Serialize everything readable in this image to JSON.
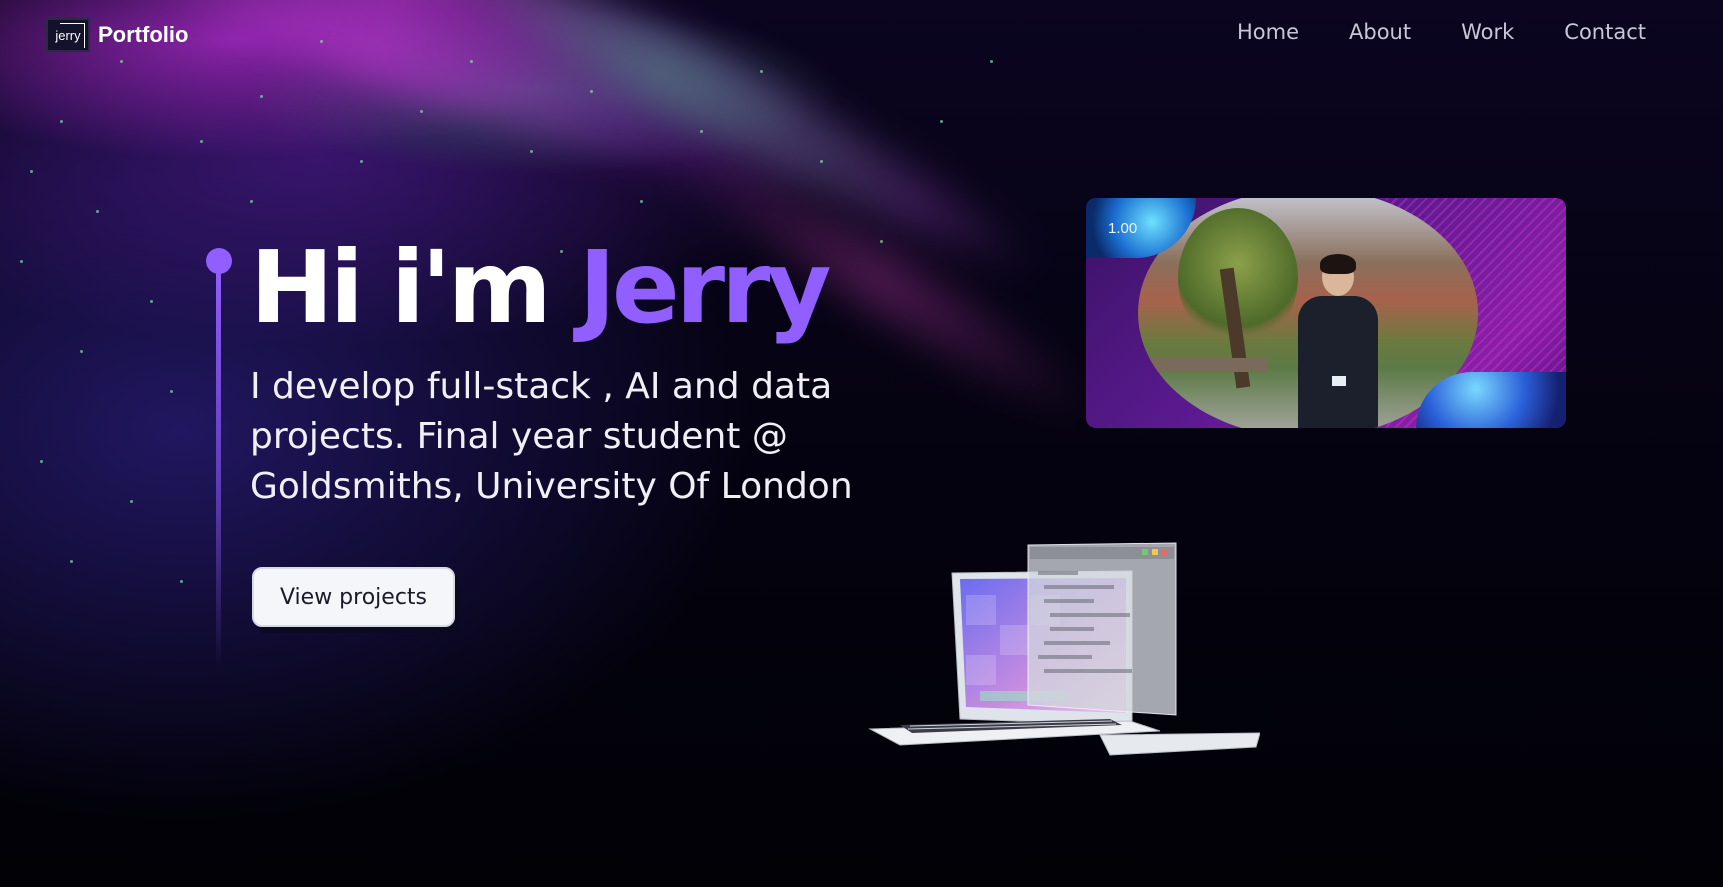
{
  "nav": {
    "logo_text": "jerry",
    "brand": "Portfolio",
    "links": [
      "Home",
      "About",
      "Work",
      "Contact"
    ]
  },
  "hero": {
    "greeting": "Hi i'm",
    "name": "Jerry",
    "subtitle": "I develop full-stack , AI and data projects. Final year student @ Goldsmiths, University Of London",
    "cta": "View projects"
  },
  "media": {
    "zoom_label": "1.00"
  },
  "colors": {
    "accent": "#915eff",
    "background": "#02010a",
    "nav_text": "#c9c6d6"
  }
}
